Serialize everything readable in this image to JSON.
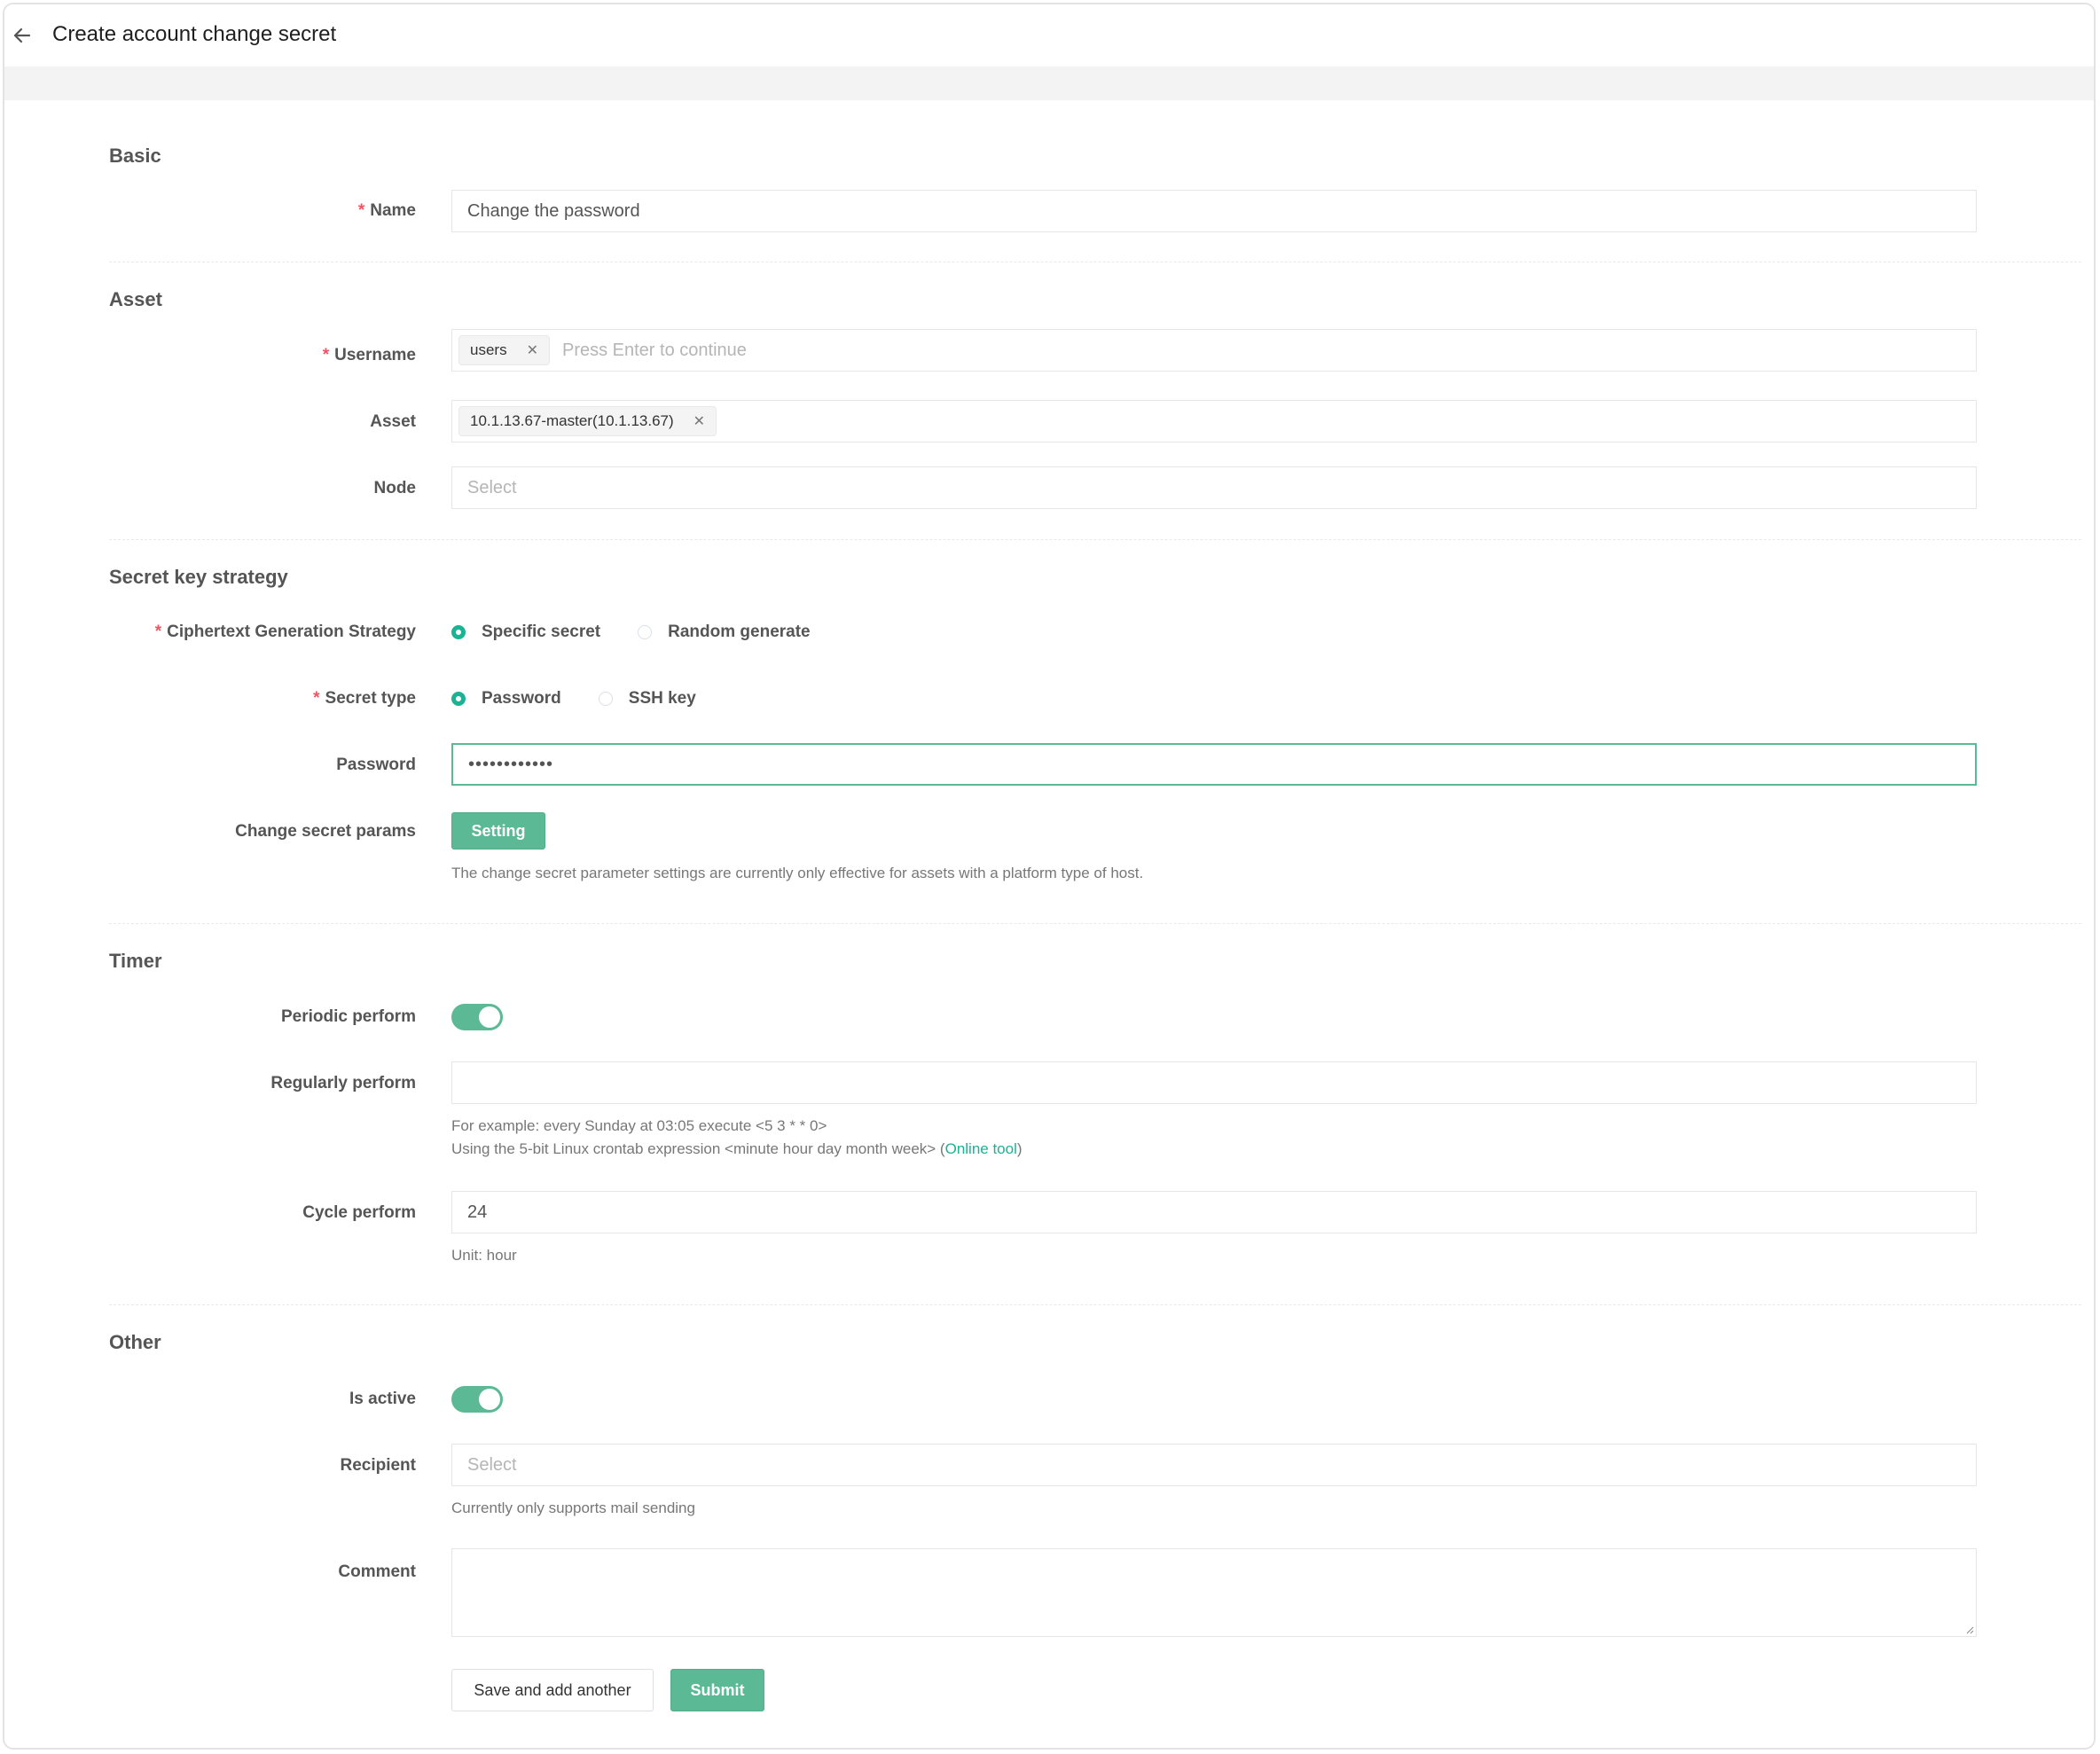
{
  "header": {
    "title": "Create account change secret"
  },
  "sections": {
    "basic": "Basic",
    "asset": "Asset",
    "secret": "Secret key strategy",
    "timer": "Timer",
    "other": "Other"
  },
  "required_mark": "*",
  "fields": {
    "name": {
      "label": "Name",
      "value": "Change the password"
    },
    "username": {
      "label": "Username",
      "tag": "users",
      "placeholder": "Press Enter to continue"
    },
    "asset": {
      "label": "Asset",
      "tag": "10.1.13.67-master(10.1.13.67)"
    },
    "node": {
      "label": "Node",
      "placeholder": "Select"
    },
    "strategy": {
      "label": "Ciphertext Generation Strategy",
      "options": [
        "Specific secret",
        "Random generate"
      ],
      "selected": "Specific secret"
    },
    "secret_type": {
      "label": "Secret type",
      "options": [
        "Password",
        "SSH key"
      ],
      "selected": "Password"
    },
    "password": {
      "label": "Password",
      "value": "••••••••••••"
    },
    "params": {
      "label": "Change secret params",
      "button": "Setting",
      "help": "The change secret parameter settings are currently only effective for assets with a platform type of host."
    },
    "periodic": {
      "label": "Periodic perform",
      "on": true
    },
    "regularly": {
      "label": "Regularly perform",
      "value": "",
      "help1": "For example: every Sunday at 03:05 execute <5 3 * * 0>",
      "help2_pre": "Using the 5-bit Linux crontab expression <minute hour day month week> (",
      "help2_link": "Online tool",
      "help2_post": ")"
    },
    "cycle": {
      "label": "Cycle perform",
      "value": "24",
      "help": "Unit: hour"
    },
    "is_active": {
      "label": "Is active",
      "on": true
    },
    "recipient": {
      "label": "Recipient",
      "placeholder": "Select",
      "help": "Currently only supports mail sending"
    },
    "comment": {
      "label": "Comment",
      "value": ""
    }
  },
  "actions": {
    "save_another": "Save and add another",
    "submit": "Submit"
  },
  "colors": {
    "accent": "#5bb995",
    "required": "#ed5565",
    "link": "#1ab394"
  },
  "icons": {
    "back": "arrow-left-icon",
    "tag_close": "close-icon"
  }
}
